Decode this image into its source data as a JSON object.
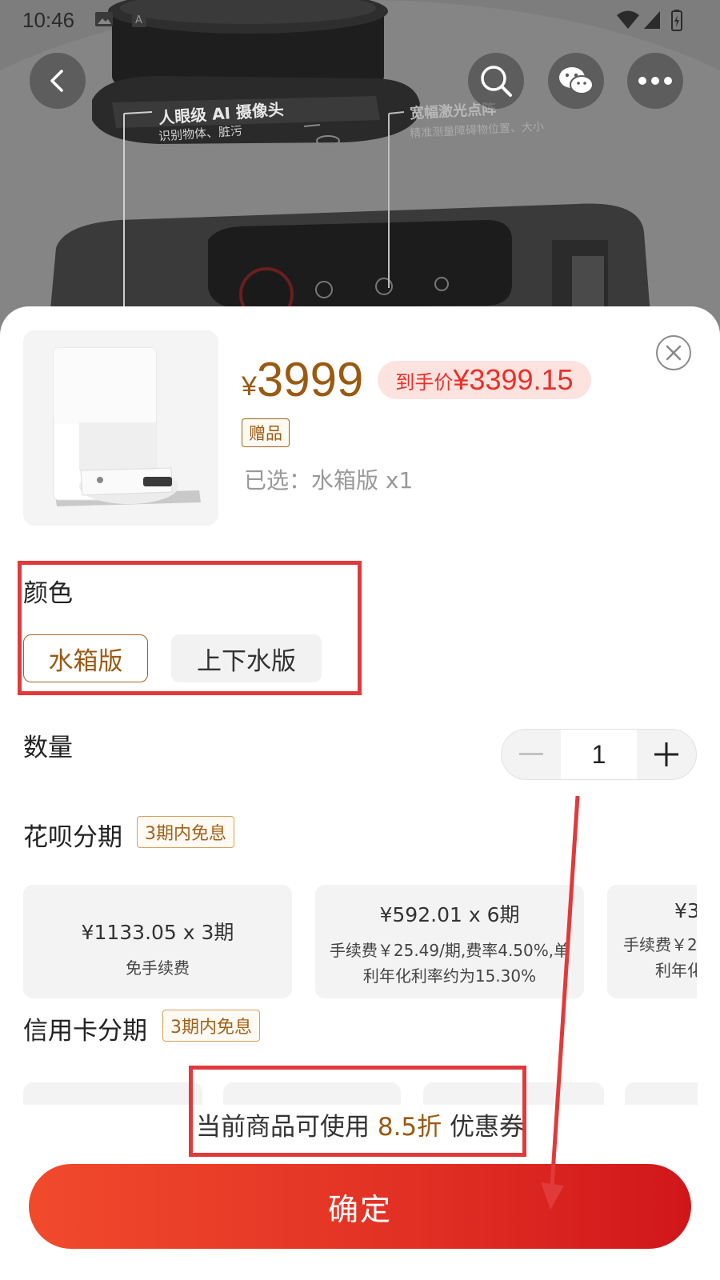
{
  "status_bar": {
    "time": "10:46"
  },
  "hero": {
    "feature1_title": "人眼级 AI 摄像头",
    "feature1_sub": "识别物体、脏污",
    "feature2_title": "宽幅激光点阵",
    "feature2_sub": "精准测量障碍物位置、大小"
  },
  "top_actions": {
    "back_icon": "back-icon",
    "search_icon": "search-icon",
    "wechat_icon": "wechat-icon",
    "more_icon": "more-icon"
  },
  "product": {
    "currency": "¥",
    "price": "3999",
    "final_price_label": "到手价",
    "final_price_value": "¥3399.15",
    "gift_tag": "赠品",
    "selected_text": "已选：水箱版 x1"
  },
  "color_section": {
    "title": "颜色",
    "options": [
      "水箱版",
      "上下水版"
    ],
    "selected": "水箱版"
  },
  "quantity": {
    "label": "数量",
    "value": "1",
    "minus": "−",
    "plus": "+"
  },
  "huabei": {
    "title": "花呗分期",
    "badge": "3期内免息",
    "plans": [
      {
        "main": "¥1133.05  x 3期",
        "sub": "免手续费"
      },
      {
        "main": "¥592.01  x 6期",
        "sub1": "手续费￥25.49/期,费率4.50%,单",
        "sub2": "利年化利率约为15.30%"
      },
      {
        "main": "¥3",
        "sub1": "手续费￥2",
        "sub2": "利年化"
      }
    ]
  },
  "credit_card": {
    "title": "信用卡分期",
    "badge": "3期内免息"
  },
  "coupon": {
    "prefix": "当前商品可使用 ",
    "highlight": "8.5折",
    "suffix": " 优惠券"
  },
  "confirm_button": "确定",
  "colors": {
    "accent_brown": "#9a5a12",
    "price_red": "#e8302a",
    "button_red": "#e12f24",
    "annotation_red": "#e03a3a"
  }
}
